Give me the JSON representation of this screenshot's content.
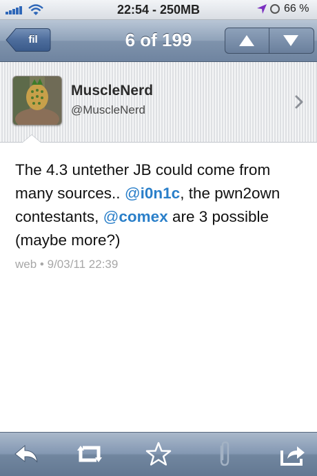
{
  "status_bar": {
    "time": "22:54",
    "network": "250MB",
    "battery": "66 %"
  },
  "nav": {
    "back_label": "fil",
    "title": "6 of 199"
  },
  "profile": {
    "display_name": "MuscleNerd",
    "handle": "@MuscleNerd"
  },
  "tweet": {
    "text_1": "The 4.3 untether JB could come from many sources.. ",
    "mention_1_at": "@",
    "mention_1_name": "i0n1c",
    "text_2": ", the pwn2own contestants, ",
    "mention_2_at": "@",
    "mention_2_name": "comex",
    "text_3": " are 3 possible (maybe more?)",
    "source": "web",
    "separator": "•",
    "timestamp": "9/03/11 22:39"
  },
  "toolbar": {
    "icons": [
      "reply-icon",
      "retweet-icon",
      "favorite-star-icon",
      "attachment-icon",
      "share-icon"
    ]
  },
  "colors": {
    "mention": "#2a7fc9",
    "meta": "#a7a7a7",
    "nav_bar": "#7f93ac"
  }
}
